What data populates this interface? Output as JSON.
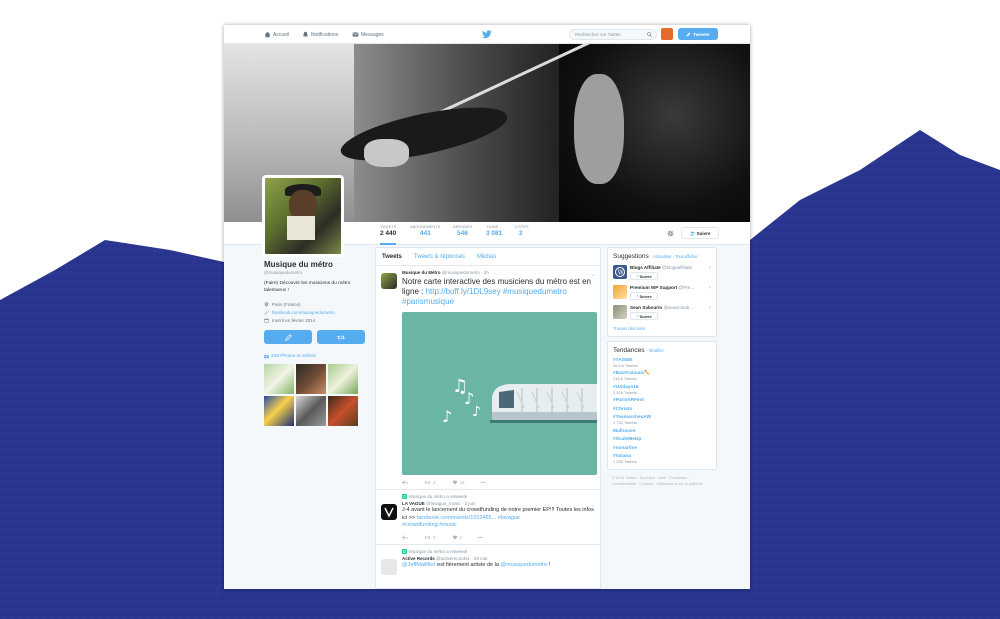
{
  "nav": {
    "home": "Accueil",
    "notifications": "Notifications",
    "messages": "Messages",
    "search_placeholder": "Recherchez sur Twitter",
    "tweet_button": "Tweeter"
  },
  "stats": [
    {
      "label": "Tweets",
      "value": "2 440"
    },
    {
      "label": "Abonnements",
      "value": "441"
    },
    {
      "label": "Abonnés",
      "value": "546"
    },
    {
      "label": "J'aime",
      "value": "3 081"
    },
    {
      "label": "Listes",
      "value": "2"
    }
  ],
  "follow_label": "Suivre",
  "profile": {
    "name": "Musique du métro",
    "handle": "@musiquedumetro",
    "bio": "(Faire) Découvrir les musiciens du métro talentueux !",
    "location": "Paris (France)",
    "website": "facebook.com/musiquedumetro",
    "joined": "Inscrit en février 2014",
    "photos": "249 Photos et vidéos"
  },
  "tabs": [
    "Tweets",
    "Tweets & réponses",
    "Médias"
  ],
  "tweets": [
    {
      "name": "Musique du Métro",
      "handle": "@musiquedumetro",
      "time": "2h",
      "text": "Notre carte interactive des musiciens du métro est en ligne : ",
      "link": "http://buff.ly/1DL9sey",
      "tags": "#musiquedumetro #parismusique",
      "retweets": "3",
      "likes": "16"
    },
    {
      "retweeted_by": "Musique du métro a retweeté",
      "name": "LA VAGUE",
      "handle": "@lavague_music",
      "time": "2 juin",
      "text": "J-4 avant le lancement du crowdfunding de notre premier EP!!! Toutes les infos ici >> ",
      "link": "facebook.com/events/1022465...",
      "tags": "#lavague",
      "tags2": "#crowdfunding #music",
      "retweets": "3",
      "likes": "2"
    },
    {
      "retweeted_by": "Musique du métro a retweeté",
      "name": "Active Records",
      "handle": "@activerecords1",
      "time": "29 mai",
      "mention1": "@JeffMaillfert",
      "text": " est fièrement artiste de la ",
      "mention2": "@musiquedumetro",
      "end": " !"
    }
  ],
  "suggestions": {
    "title": "Suggestions",
    "actions": "· Actualiser · Tout afficher",
    "items": [
      {
        "name": "Blogs Affiliate",
        "handle": "@blogsaffiliate",
        "color": "#3b5a8c"
      },
      {
        "name": "Premium WP Support",
        "handle": "@Pre...",
        "color": "#f4a233"
      },
      {
        "name": "Sean Sabourin",
        "handle": "@seanmsab...",
        "color": "#8d8d7a"
      }
    ],
    "find": "Trouver des amis"
  },
  "trends": {
    "title": "Tendances",
    "action": "· Modifier",
    "items": [
      {
        "tag": "#TASWE",
        "count": "36,6 k Tweets"
      },
      {
        "tag": "#BacFrancais✏️",
        "count": "216 k Tweets"
      },
      {
        "tag": "#UXdays16",
        "count": "3 429 Tweets"
      },
      {
        "tag": "#ParisVRFest",
        "count": ""
      },
      {
        "tag": "#Christo",
        "count": ""
      },
      {
        "tag": "#TeamarchesAW",
        "count": "1 732 Tweets"
      },
      {
        "tag": "Mulhouse",
        "count": ""
      },
      {
        "tag": "#ScaleMeUp",
        "count": ""
      },
      {
        "tag": "#sonartive",
        "count": ""
      },
      {
        "tag": "#Vaiana",
        "count": "1 030 Tweets"
      }
    ]
  },
  "footer": "© 2016 Twitter · À propos · Aide · Conditions · Confidentialité · Cookies · Informations sur la publicité",
  "colors": {
    "accent": "#55acee",
    "background_wave": "#2a3590"
  }
}
